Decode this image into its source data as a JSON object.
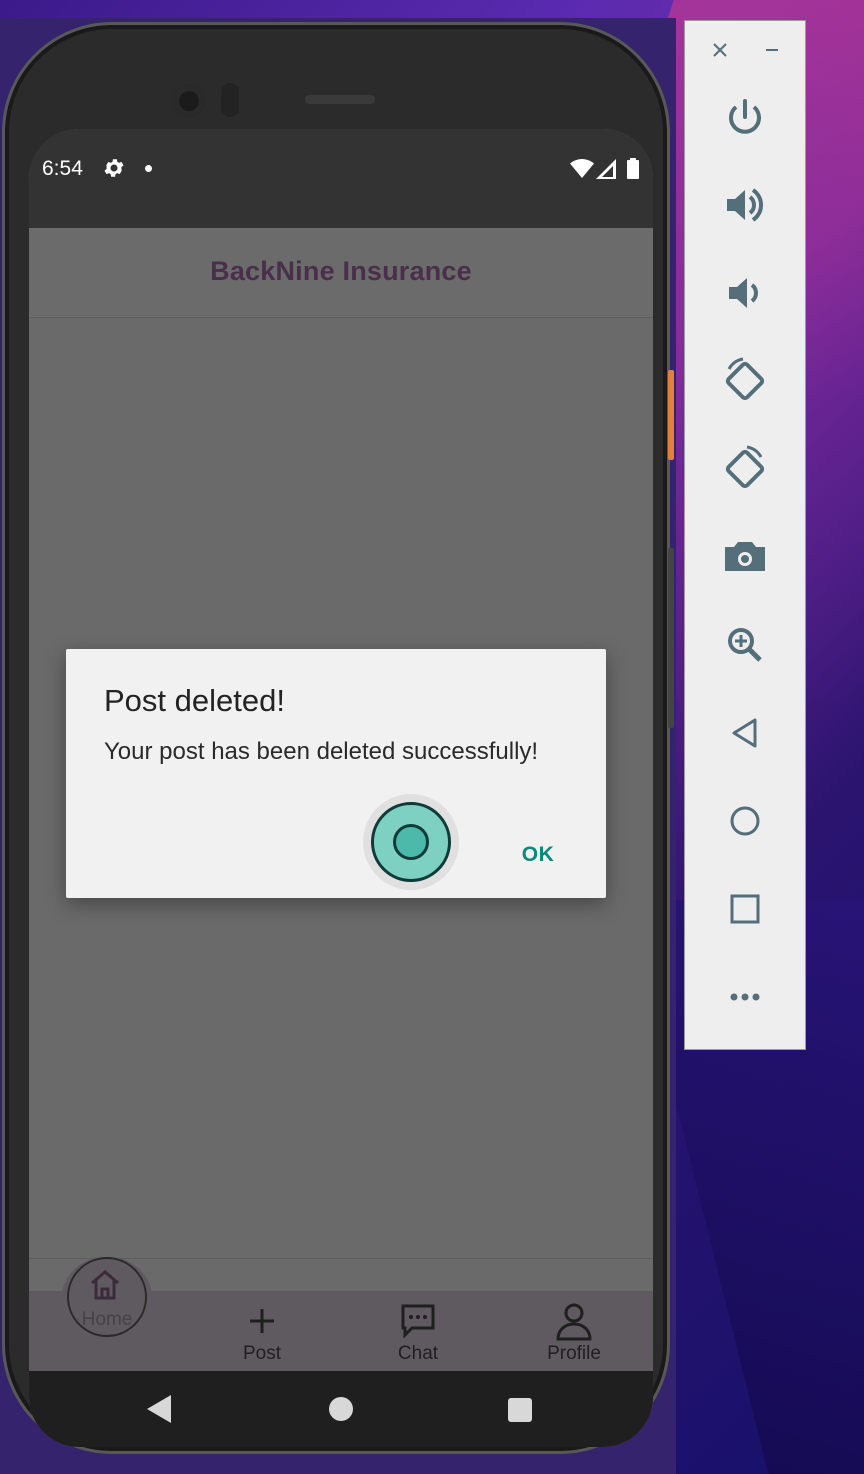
{
  "status_bar": {
    "time": "6:54"
  },
  "app_bar": {
    "title": "BackNine Insurance"
  },
  "dialog": {
    "title": "Post deleted!",
    "message": "Your post has been deleted successfully!",
    "ok_label": "OK"
  },
  "bottom_nav": {
    "items": [
      {
        "label": "Home",
        "icon": "home-icon"
      },
      {
        "label": "Post",
        "icon": "plus-icon"
      },
      {
        "label": "Chat",
        "icon": "chat-icon"
      },
      {
        "label": "Profile",
        "icon": "person-icon"
      }
    ]
  },
  "emulator_toolbar": {
    "buttons": [
      "close-icon",
      "minimize-icon",
      "power-icon",
      "volume-up-icon",
      "volume-down-icon",
      "rotate-left-icon",
      "rotate-right-icon",
      "camera-icon",
      "zoom-icon",
      "back-icon",
      "home-icon",
      "overview-icon",
      "more-icon"
    ]
  },
  "colors": {
    "accent": "#078a7a",
    "app_title": "#4a2f4a",
    "touch_indicator": "#7ed0c2"
  }
}
